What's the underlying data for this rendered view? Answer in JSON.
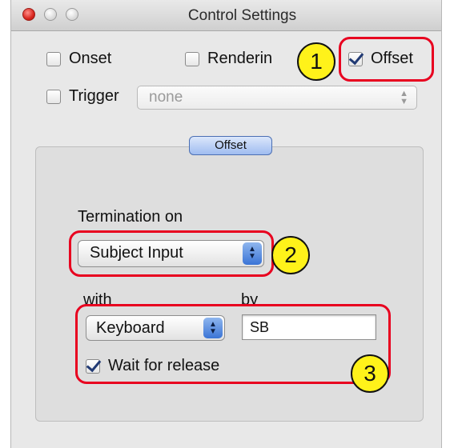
{
  "window": {
    "title": "Control Settings"
  },
  "top_checkboxes": {
    "onset": {
      "label": "Onset",
      "checked": false
    },
    "rendering": {
      "label": "Renderin",
      "checked": false
    },
    "offset": {
      "label": "Offset",
      "checked": true
    },
    "trigger": {
      "label": "Trigger",
      "checked": false
    }
  },
  "trigger_select": {
    "value": "none",
    "disabled": true
  },
  "group": {
    "tab_label": "Offset",
    "termination_label": "Termination on",
    "termination_value": "Subject Input",
    "with_label": "with",
    "by_label": "by",
    "device_value": "Keyboard",
    "by_value": "SB",
    "wait_label": "Wait for release",
    "wait_checked": true
  },
  "callouts": {
    "c1": "1",
    "c2": "2",
    "c3": "3"
  },
  "colors": {
    "highlight": "#e8001f",
    "callout_fill": "#fff21a",
    "tab_blue": "#9fbcf0"
  },
  "icons": {
    "stepper": "up-down-arrows-icon",
    "checkmark": "checkmark-icon"
  }
}
